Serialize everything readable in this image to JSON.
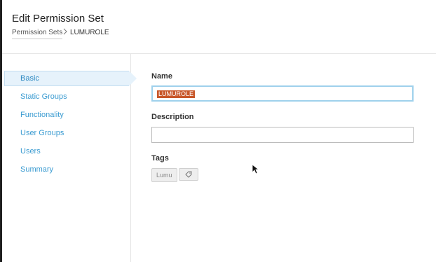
{
  "header": {
    "title": "Edit Permission Set",
    "breadcrumb": {
      "parent": "Permission Sets",
      "current": "LUMUROLE"
    }
  },
  "sidebar": {
    "items": [
      {
        "label": "Basic",
        "active": true
      },
      {
        "label": "Static Groups"
      },
      {
        "label": "Functionality"
      },
      {
        "label": "User Groups"
      },
      {
        "label": "Users"
      },
      {
        "label": "Summary"
      }
    ]
  },
  "form": {
    "name_label": "Name",
    "name_value": "LUMUROLE",
    "description_label": "Description",
    "description_value": "",
    "tags_label": "Tags",
    "tags": [
      "Lumu"
    ],
    "add_tag_icon": "tag-icon"
  },
  "colors": {
    "link": "#3a9bd1",
    "active_bg": "#e6f2fb",
    "selection": "#c8572a",
    "focus": "#9fd1ec"
  }
}
